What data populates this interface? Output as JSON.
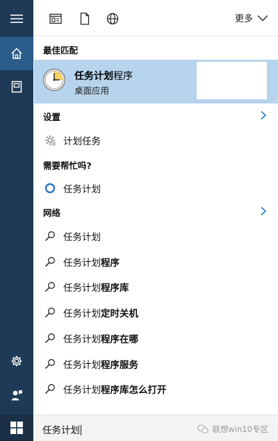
{
  "toolbar": {
    "icons": [
      "apps-icon",
      "document-icon",
      "web-icon"
    ],
    "more_label": "更多"
  },
  "rail": {
    "items": [
      {
        "name": "menu-icon"
      },
      {
        "name": "home-icon",
        "active": true
      },
      {
        "name": "notebook-icon"
      },
      {
        "name": "settings-icon"
      },
      {
        "name": "feedback-icon"
      }
    ]
  },
  "best_match": {
    "header": "最佳匹配",
    "title_bold": "任务计划",
    "title_rest": "程序",
    "subtitle": "桌面应用"
  },
  "settings": {
    "header": "设置",
    "items": [
      {
        "label": "计划任务"
      }
    ]
  },
  "help": {
    "header": "需要帮忙吗?",
    "items": [
      {
        "label": "任务计划"
      }
    ]
  },
  "web": {
    "header": "网络",
    "items": [
      {
        "plain": "任务计划",
        "bold": ""
      },
      {
        "plain": "任务计划",
        "bold": "程序"
      },
      {
        "plain": "任务计划",
        "bold": "程序库"
      },
      {
        "plain": "任务计划",
        "bold": "定时关机"
      },
      {
        "plain": "任务计划",
        "bold": "程序在哪"
      },
      {
        "plain": "任务计划",
        "bold": "程序服务"
      },
      {
        "plain": "任务计划",
        "bold": "程序库怎么打开"
      }
    ]
  },
  "search": {
    "query": "任务计划",
    "watermark": "联想win10专区"
  },
  "colors": {
    "rail_bg": "#1f3a57",
    "rail_active": "#2b5b88",
    "highlight": "#b7d4ee",
    "accent": "#2b78c2"
  }
}
